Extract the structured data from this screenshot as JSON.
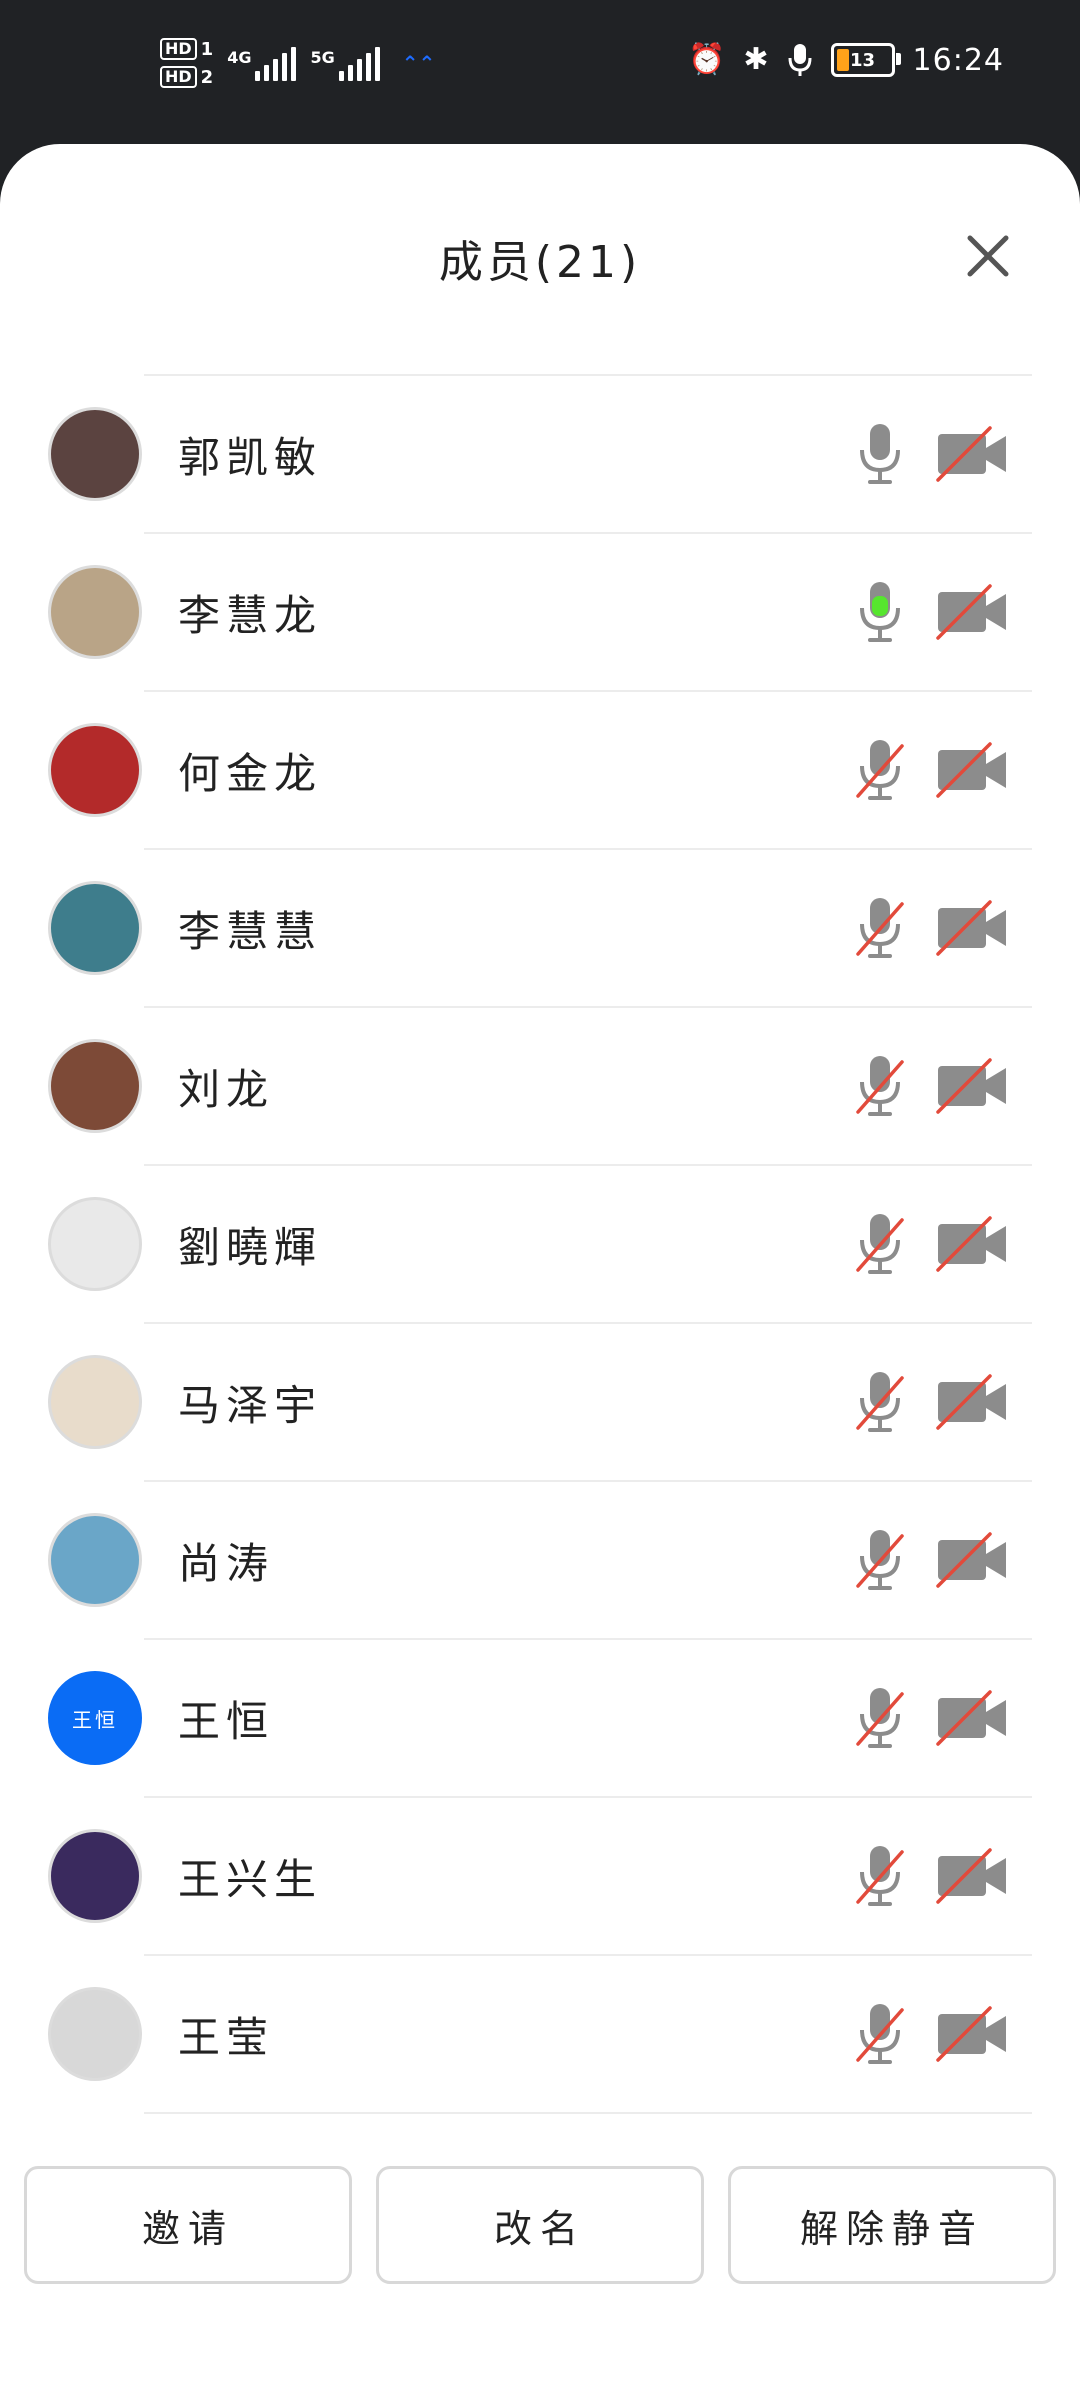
{
  "status_bar": {
    "hd1": "HD",
    "hd1_num": "1",
    "hd2": "HD",
    "hd2_num": "2",
    "net1": "4G",
    "net2": "5G",
    "battery": "13",
    "time": "16:24"
  },
  "sheet": {
    "title": "成员(21)"
  },
  "members": [
    {
      "name": "郭凯敏",
      "avatar_color": "#5b4340",
      "avatar_text": "",
      "mic": "inactive",
      "cam": "off"
    },
    {
      "name": "李慧龙",
      "avatar_color": "#b9a487",
      "avatar_text": "",
      "mic": "speaking",
      "cam": "off"
    },
    {
      "name": "何金龙",
      "avatar_color": "#b32a2a",
      "avatar_text": "",
      "mic": "muted",
      "cam": "off"
    },
    {
      "name": "李慧慧",
      "avatar_color": "#3e7d8c",
      "avatar_text": "",
      "mic": "muted",
      "cam": "off"
    },
    {
      "name": "刘龙",
      "avatar_color": "#7d4a37",
      "avatar_text": "",
      "mic": "muted",
      "cam": "off"
    },
    {
      "name": "劉曉輝",
      "avatar_color": "#e9e9e9",
      "avatar_text": "",
      "mic": "muted",
      "cam": "off"
    },
    {
      "name": "马泽宇",
      "avatar_color": "#e8dccb",
      "avatar_text": "",
      "mic": "muted",
      "cam": "off"
    },
    {
      "name": "尚涛",
      "avatar_color": "#6aa6c8",
      "avatar_text": "",
      "mic": "muted",
      "cam": "off"
    },
    {
      "name": "王恒",
      "avatar_color": "#0a6cf5",
      "avatar_text": "王恒",
      "mic": "muted",
      "cam": "off"
    },
    {
      "name": "王兴生",
      "avatar_color": "#3a2a5e",
      "avatar_text": "",
      "mic": "muted",
      "cam": "off"
    },
    {
      "name": "王莹",
      "avatar_color": "#d8d8d8",
      "avatar_text": "",
      "mic": "muted",
      "cam": "off"
    }
  ],
  "buttons": {
    "invite": "邀请",
    "rename": "改名",
    "unmute": "解除静音"
  },
  "colors": {
    "speaking": "#56e62e",
    "muted_slash": "#e24a3b",
    "icon_gray": "#8c8c8c"
  }
}
